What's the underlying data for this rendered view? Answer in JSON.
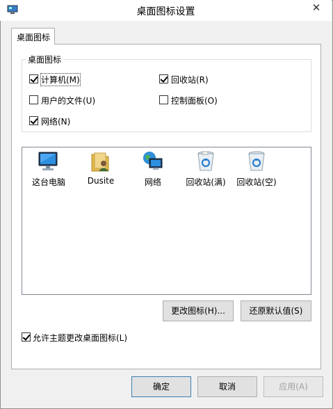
{
  "window": {
    "title": "桌面图标设置",
    "close_glyph": "✕"
  },
  "tab": {
    "label": "桌面图标"
  },
  "group": {
    "legend": "桌面图标",
    "checkboxes": [
      {
        "label": "计算机(M)",
        "checked": true
      },
      {
        "label": "回收站(R)",
        "checked": true
      },
      {
        "label": "用户的文件(U)",
        "checked": false
      },
      {
        "label": "控制面板(O)",
        "checked": false
      },
      {
        "label": "网络(N)",
        "checked": true
      }
    ]
  },
  "icons": [
    {
      "label": "这台电脑",
      "icon": "computer-icon"
    },
    {
      "label": "Dusite",
      "icon": "user-folder-icon"
    },
    {
      "label": "网络",
      "icon": "network-icon"
    },
    {
      "label": "回收站(满)",
      "icon": "recycle-bin-full-icon"
    },
    {
      "label": "回收站(空)",
      "icon": "recycle-bin-empty-icon"
    }
  ],
  "buttons": {
    "change_icon": "更改图标(H)...",
    "restore_default": "还原默认值(S)",
    "ok": "确定",
    "cancel": "取消",
    "apply": "应用(A)"
  },
  "allow_theme": {
    "label": "允许主题更改桌面图标(L)",
    "checked": true
  }
}
